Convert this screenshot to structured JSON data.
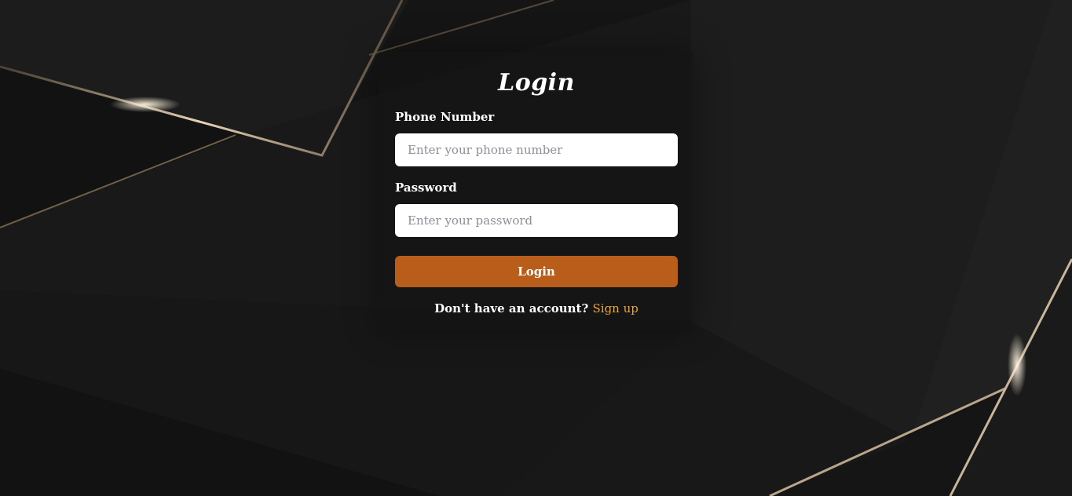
{
  "page": {
    "title": "Login"
  },
  "form": {
    "phone": {
      "label": "Phone Number",
      "placeholder": "Enter your phone number",
      "value": ""
    },
    "password": {
      "label": "Password",
      "placeholder": "Enter your password",
      "value": ""
    },
    "submit_label": "Login"
  },
  "footer": {
    "prompt": "Don't have an account?",
    "link_label": "Sign up"
  },
  "colors": {
    "background": "#151515",
    "accent_button": "#b95d1a",
    "link": "#e8a43a",
    "text": "#ffffff"
  }
}
